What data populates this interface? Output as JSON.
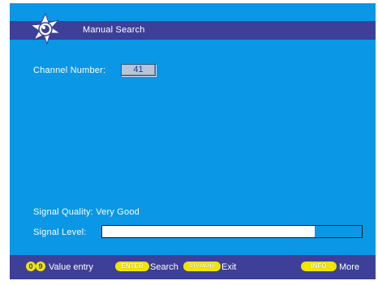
{
  "header": {
    "title": "Manual Search",
    "logo_icon": "satellite-dish-icon"
  },
  "channel": {
    "label": "Channel Number:",
    "value": "41"
  },
  "signal": {
    "quality_label": "Signal Quality:",
    "quality_value": "Very Good",
    "level_label": "Signal Level:",
    "level": 0.82
  },
  "footer": {
    "digit_start": "0",
    "digit_end": "9",
    "value_entry": "Value entry",
    "enter_key": "ENTER",
    "search": "Search",
    "menu_key": "DTV MENU",
    "exit": "Exit",
    "info_key": "INFO",
    "more": "More"
  },
  "colors": {
    "screen_bg": "#0a97e6",
    "bar_bg": "#3d3f98",
    "key_yellow": "#f2e600"
  }
}
